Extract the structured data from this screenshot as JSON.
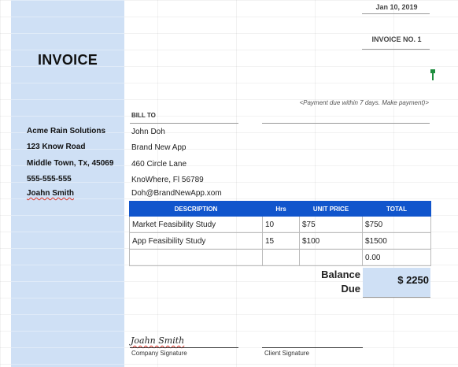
{
  "header": {
    "date": "Jan 10, 2019",
    "invoice_no": "INVOICE NO. 1"
  },
  "title": "INVOICE",
  "payment_note": "<Payment due within 7 days. Make payment)>",
  "seller": {
    "name": "Acme Rain Solutions",
    "address": "123 Know Road",
    "city": "Middle Town, Tx, 45069",
    "phone": "555-555-555",
    "contact": "Joahn Smith"
  },
  "bill_to": {
    "label": "BILL TO",
    "name": "John Doh",
    "company": "Brand New App",
    "address": "460 Circle Lane",
    "city": "KnoWhere, Fl 56789",
    "email": "Doh@BrandNewApp.xom"
  },
  "table": {
    "columns": [
      "DESCRIPTION",
      "Hrs",
      "UNIT PRICE",
      "TOTAL"
    ],
    "rows": [
      {
        "description": "Market Feasibility Study",
        "hrs": "10",
        "unit_price": "$75",
        "total": "$750"
      },
      {
        "description": "App Feasibility Study",
        "hrs": "15",
        "unit_price": "$100",
        "total": "$1500"
      },
      {
        "description": "",
        "hrs": "",
        "unit_price": "",
        "total": "0.00"
      }
    ]
  },
  "balance": {
    "label": "Balance Due",
    "value": "$ 2250"
  },
  "signatures": {
    "company_name": "Joahn Smith",
    "company_label": "Company Signature",
    "client_label": "Client Signature"
  },
  "colors": {
    "band": "#cfe0f5",
    "header": "#1155cc",
    "marker": "#1e8e3e"
  }
}
